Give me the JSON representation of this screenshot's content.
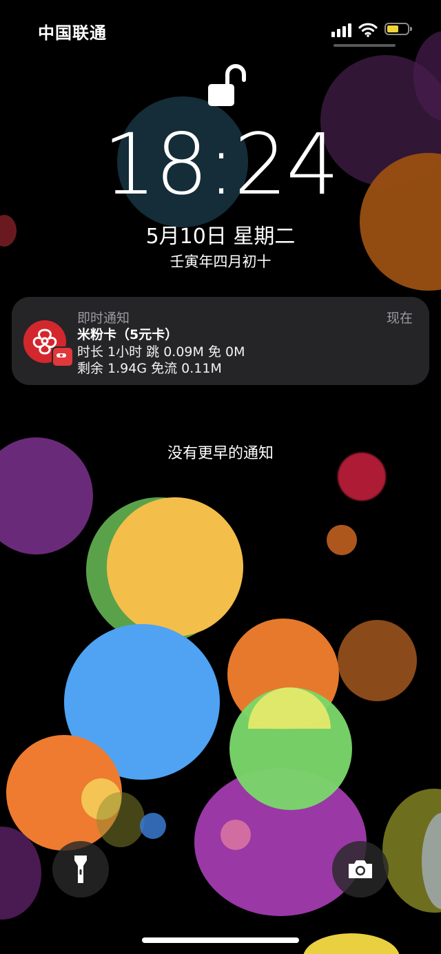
{
  "status_bar": {
    "carrier": "中国联通",
    "icons": [
      "cellular-signal-icon",
      "wifi-icon",
      "battery-icon"
    ],
    "battery_level": 0.45
  },
  "lock_screen": {
    "lock_state": "unlocked",
    "time": "18:24",
    "date": "5月10日 星期二",
    "lunar_date": "壬寅年四月初十"
  },
  "notification": {
    "app_name": "即时通知",
    "timestamp": "现在",
    "title": "米粉卡（5元卡）",
    "line1": "时长 1小时 跳 0.09M 免 0M",
    "line2": "剩余 1.94G 免流 0.11M",
    "icon": "china-unicom-logo-icon",
    "accent_color": "#d3272e"
  },
  "no_earlier_notifications": "没有更早的通知",
  "quick_actions": {
    "flashlight": "flashlight-icon",
    "camera": "camera-icon"
  }
}
